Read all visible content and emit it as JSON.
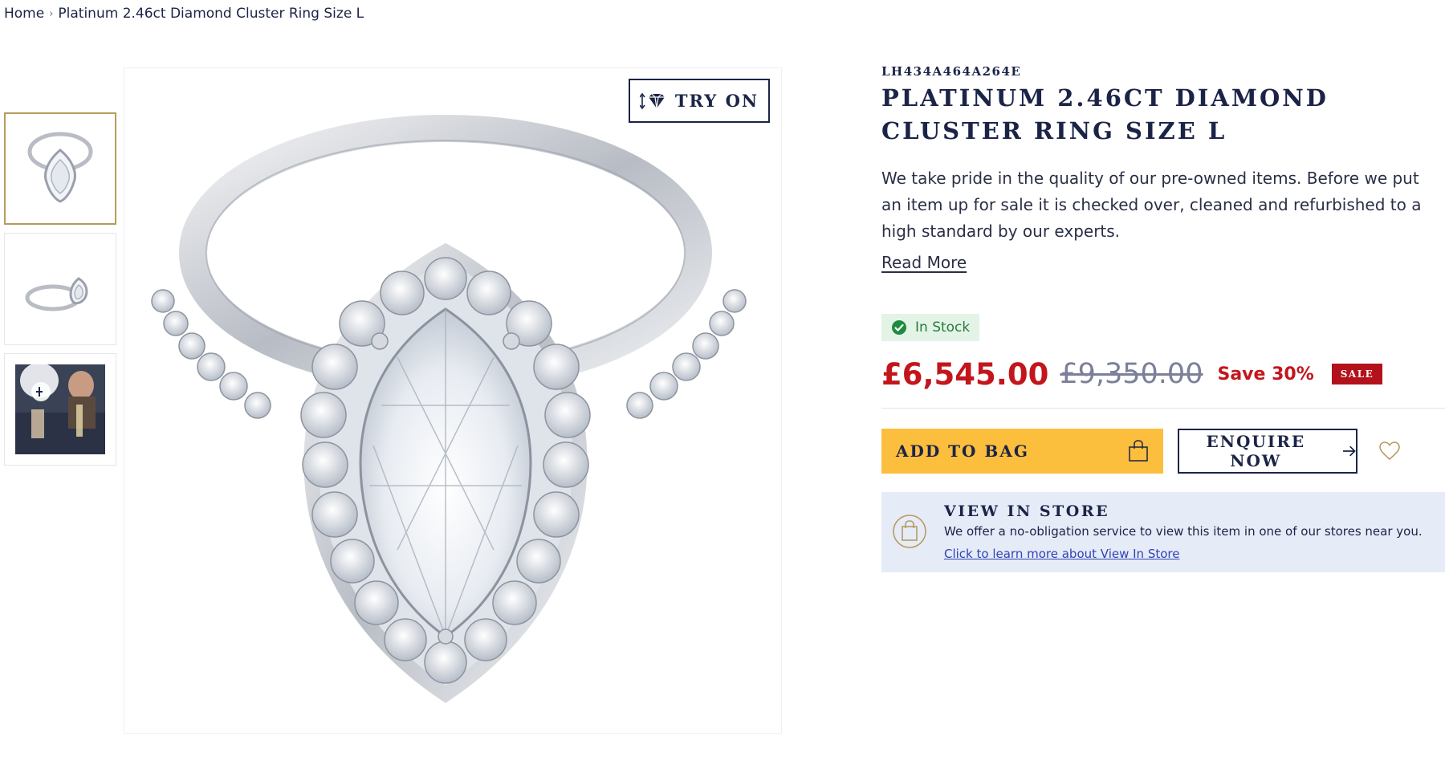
{
  "breadcrumb": {
    "home": "Home",
    "separator": "›",
    "current": "Platinum 2.46ct Diamond Cluster Ring Size L"
  },
  "gallery": {
    "thumbnails": [
      "ring-front-view",
      "ring-side-view",
      "try-on-video"
    ],
    "selected_index": 0
  },
  "try_on": {
    "label": "TRY ON",
    "icon": "diamond-icon"
  },
  "product": {
    "sku": "LH434A464A264E",
    "title": "PLATINUM 2.46CT DIAMOND CLUSTER RING SIZE L",
    "description": "We take pride in the quality of our pre-owned items. Before we put an item up for sale it is checked over, cleaned and refurbished to a high standard by our experts.",
    "read_more": "Read More"
  },
  "stock": {
    "label": "In Stock",
    "icon": "check-circle-icon",
    "color": "#2a7a3d"
  },
  "pricing": {
    "current": "£6,545.00",
    "was": "£9,350.00",
    "save": "Save 30%",
    "badge": "SALE",
    "sale_color": "#c3161c"
  },
  "actions": {
    "add_to_bag": "ADD TO BAG",
    "add_to_bag_icon": "shopping-bag-icon",
    "add_to_bag_color": "#fcbe3d",
    "enquire": "ENQUIRE NOW",
    "enquire_icon": "arrow-right-icon",
    "wishlist_icon": "heart-icon"
  },
  "view_in_store": {
    "title": "VIEW IN STORE",
    "description": "We offer a no-obligation service to view this item in one of our stores near you.",
    "link": "Click to learn more about View In Store",
    "icon": "store-bag-icon"
  },
  "colors": {
    "navy": "#1b2447",
    "gold": "#b79b5e",
    "store_bg": "#e6ebf8"
  }
}
